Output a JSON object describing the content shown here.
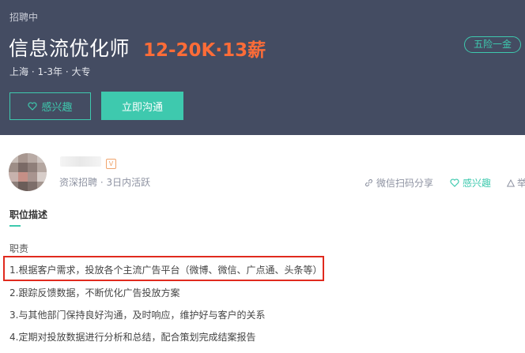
{
  "job": {
    "status": "招聘中",
    "title": "信息流优化师",
    "salary": "12-20K·13薪",
    "meta": "上海 · 1-3年 · 大专",
    "benefit": "五险一金"
  },
  "actions": {
    "interest_label": "感兴趣",
    "chat_label": "立即沟通"
  },
  "recruiter": {
    "badge": "V",
    "info": "资深招聘 · 3日内活跃"
  },
  "toolbar": {
    "share_label": "微信扫码分享",
    "fav_label": "感兴趣",
    "report_label": "举"
  },
  "description": {
    "section_title": "职位描述",
    "duties_label": "职责",
    "duties": [
      "1.根据客户需求，投放各个主流广告平台（微博、微信、广点通、头条等）",
      "2.跟踪反馈数据，不断优化广告投放方案",
      "3.与其他部门保持良好沟通，及时响应，维护好与客户的关系",
      "4.定期对投放数据进行分析和总结，配合策划完成结案报告"
    ]
  },
  "colors": {
    "header_bg": "#444c62",
    "accent": "#3ec9ae",
    "salary": "#fc6c38",
    "highlight": "#e02a1e"
  }
}
